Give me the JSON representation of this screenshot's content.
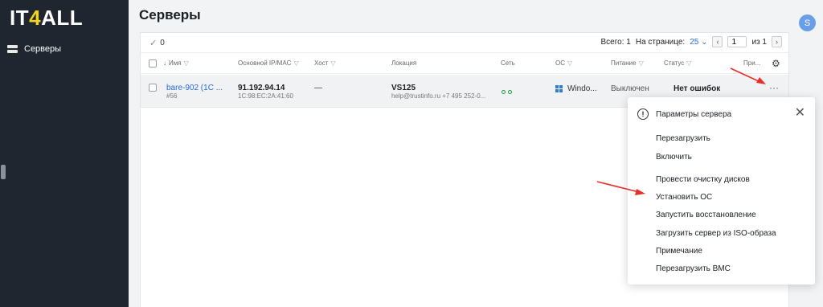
{
  "logo": {
    "left": "IT",
    "mid": "4",
    "right": "ALL"
  },
  "sidebar": {
    "items": [
      {
        "label": "Серверы",
        "icon": "server-icon"
      }
    ]
  },
  "header": {
    "title": "Серверы",
    "avatar_letter": "S"
  },
  "toolbar": {
    "selected_count": "0",
    "total_label": "Всего: 1",
    "per_page_label": "На странице:",
    "per_page_value": "25",
    "page_value": "1",
    "of_label": "из 1"
  },
  "table": {
    "columns": [
      "Имя",
      "Основной IP/MAC",
      "Хост",
      "Локация",
      "Сеть",
      "ОС",
      "Питание",
      "Статус",
      "При..."
    ],
    "rows": [
      {
        "name": "bare-902 (1С ...",
        "id": "#56",
        "ip": "91.192.94.14",
        "mac": "1C:98:EC:2A:41:60",
        "host": "—",
        "location": "VS125",
        "location_sub": "help@trustinfo.ru +7 495 252-0...",
        "os": "Windo...",
        "power": "Выключен",
        "status": "Нет ошибок",
        "more": "···"
      }
    ]
  },
  "menu": {
    "title": "Параметры сервера",
    "items": [
      "Перезагрузить",
      "Включить",
      "Провести очистку дисков",
      "Установить ОС",
      "Запустить восстановление",
      "Загрузить сервер из ISO-образа",
      "Примечание",
      "Перезагрузить BMC"
    ]
  },
  "colors": {
    "sidebar": "#1f2630",
    "accent": "#2a6bd8",
    "annotation_arrow": "#e5302a",
    "logo_accent": "#f5d21c"
  }
}
